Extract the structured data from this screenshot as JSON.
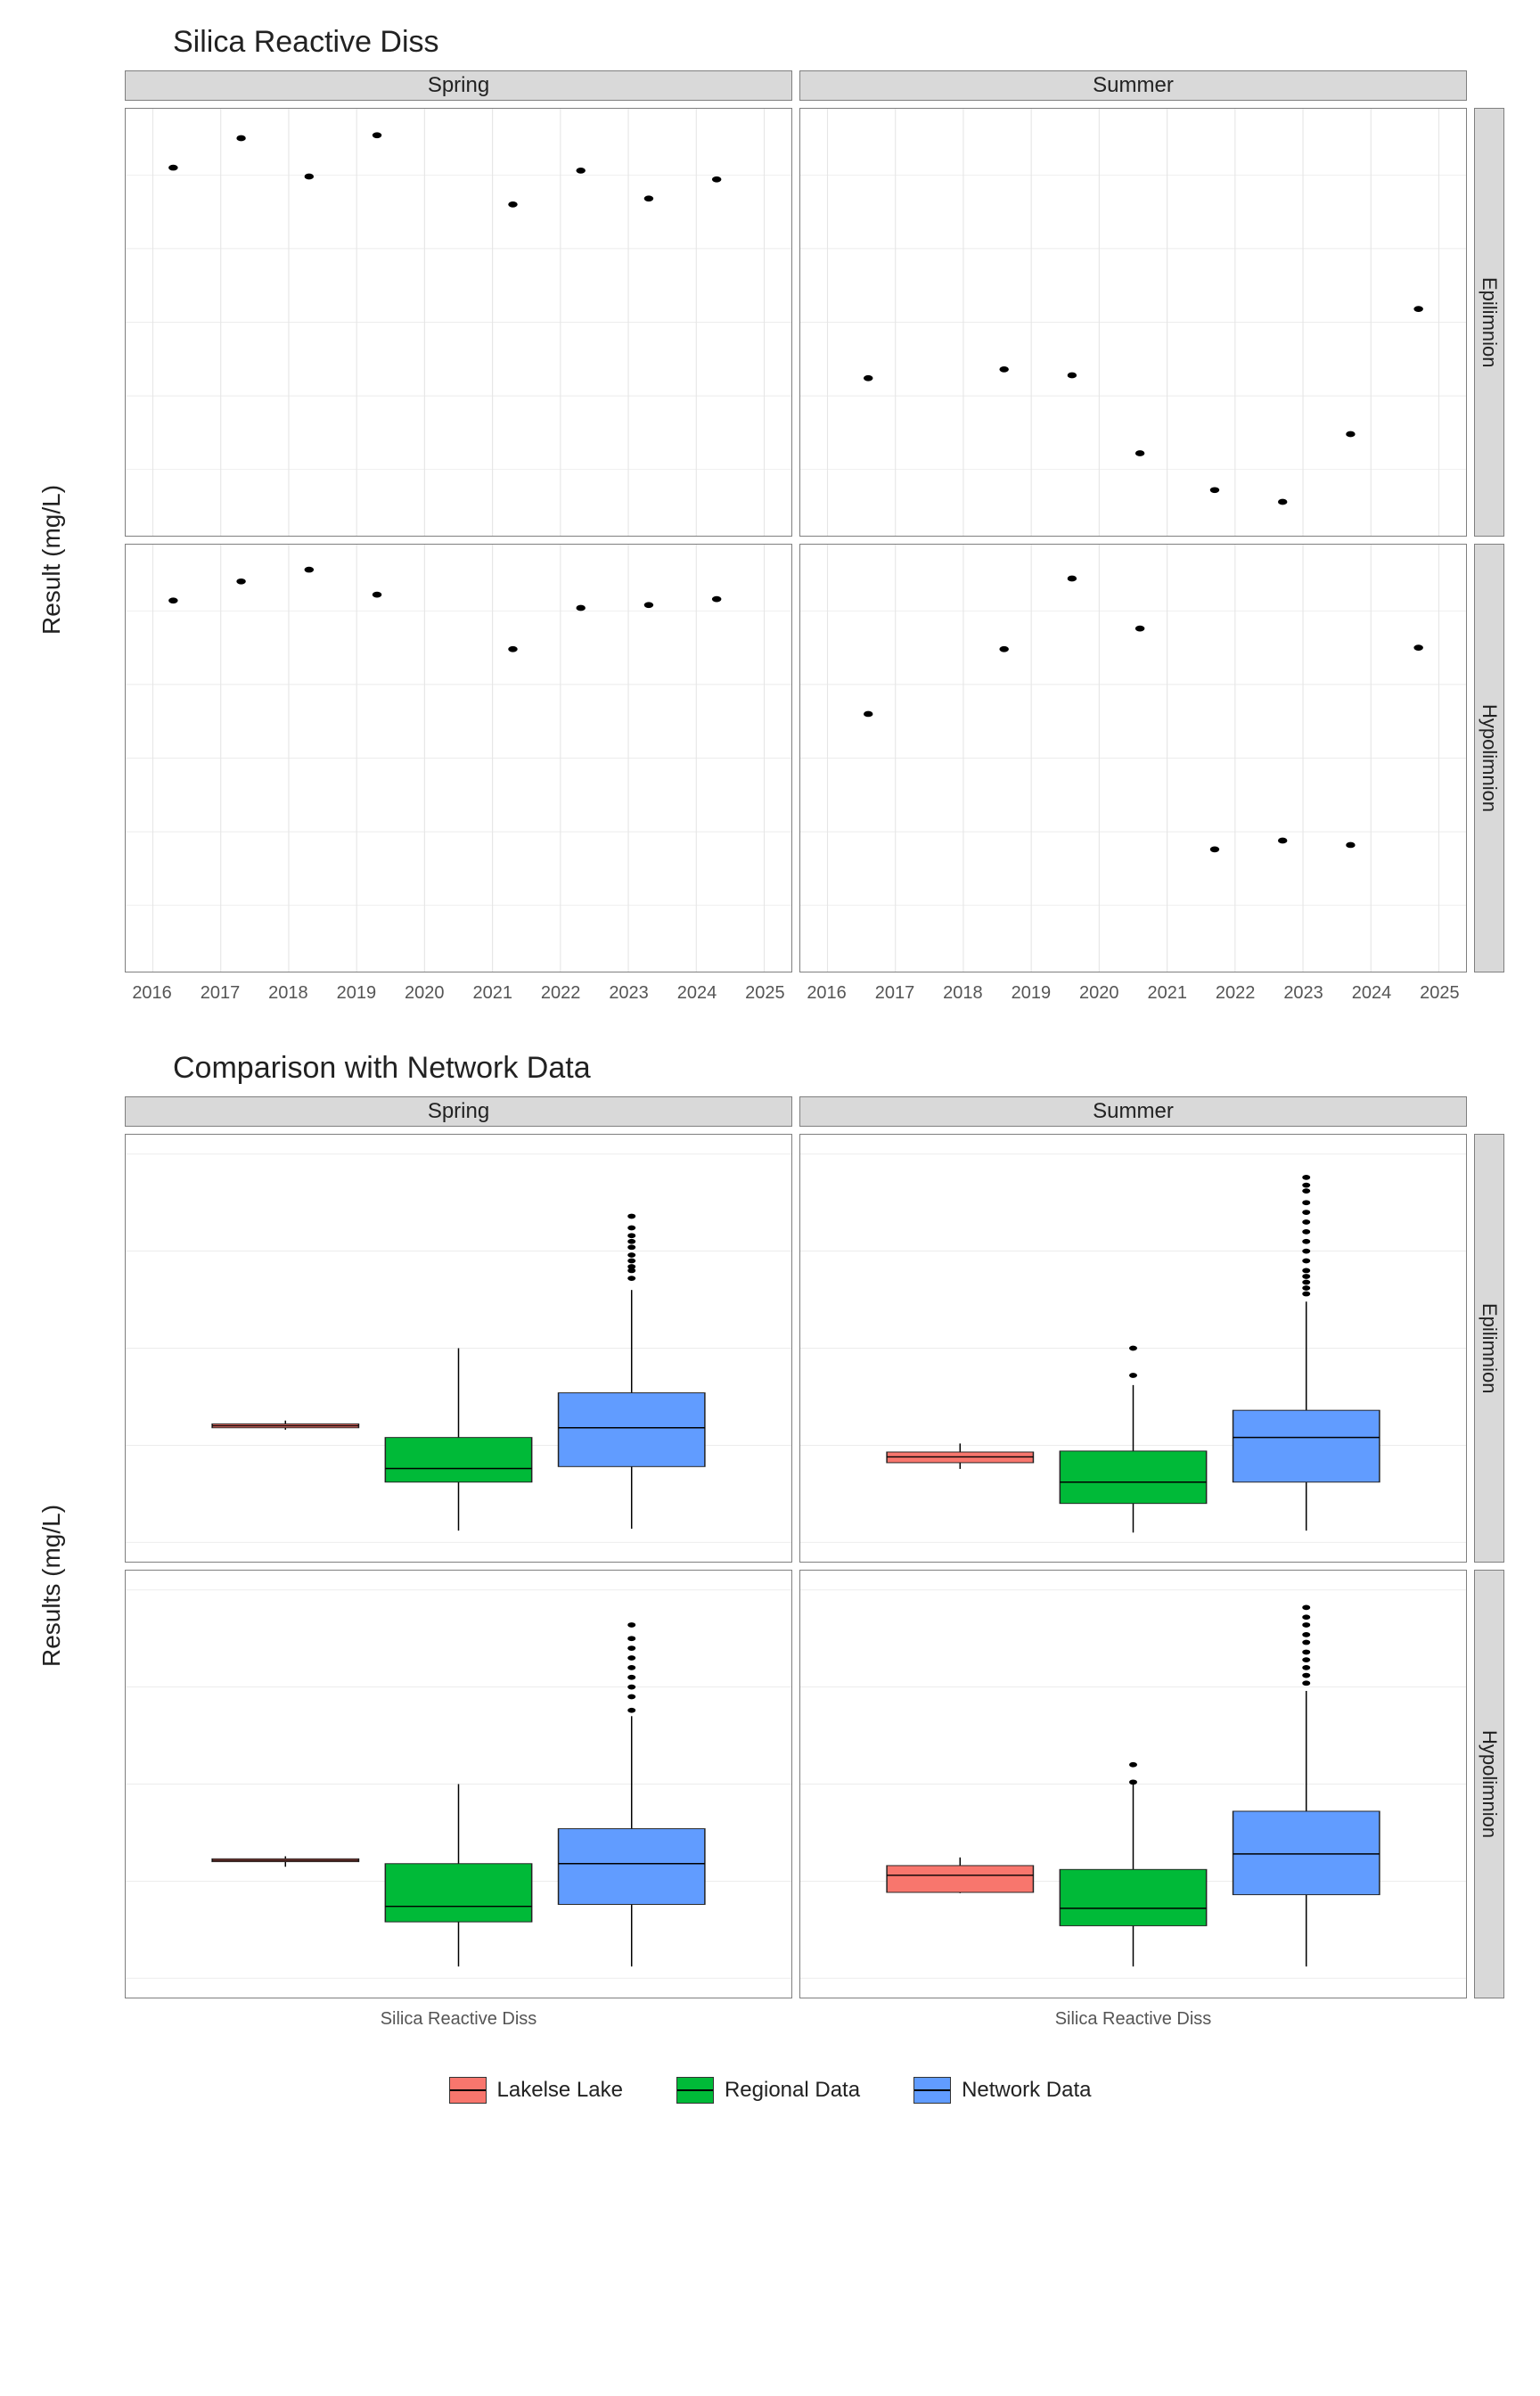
{
  "scatter": {
    "title": "Silica Reactive Diss",
    "ylab": "Result (mg/L)",
    "cols": [
      "Spring",
      "Summer"
    ],
    "rows": [
      "Epilimnion",
      "Hypolimnion"
    ],
    "x_ticks": [
      2016,
      2017,
      2018,
      2019,
      2020,
      2021,
      2022,
      2023,
      2024,
      2025
    ],
    "y_ticks": [
      4.0,
      4.5,
      5.0,
      5.5,
      6.0
    ],
    "xlim": [
      2015.6,
      2025.4
    ],
    "ylim": [
      3.55,
      6.45
    ]
  },
  "box": {
    "title": "Comparison with Network Data",
    "ylab": "Results (mg/L)",
    "cols": [
      "Spring",
      "Summer"
    ],
    "rows": [
      "Epilimnion",
      "Hypolimnion"
    ],
    "xcat": "Silica Reactive Diss",
    "y_ticks": [
      0,
      5,
      10,
      15,
      20
    ],
    "ylim": [
      -1,
      21
    ],
    "groups": [
      "Lakelse Lake",
      "Regional Data",
      "Network Data"
    ],
    "colors": {
      "Lakelse Lake": "#F8766D",
      "Regional Data": "#00BA38",
      "Network Data": "#619CFF"
    }
  },
  "legend": [
    {
      "label": "Lakelse Lake",
      "color": "#F8766D"
    },
    {
      "label": "Regional Data",
      "color": "#00BA38"
    },
    {
      "label": "Network Data",
      "color": "#619CFF"
    }
  ],
  "chart_data": [
    {
      "type": "scatter",
      "title": "Silica Reactive Diss",
      "facets_col": [
        "Spring",
        "Summer"
      ],
      "facets_row": [
        "Epilimnion",
        "Hypolimnion"
      ],
      "xlabel": "",
      "ylabel": "Result (mg/L)",
      "xlim": [
        2015.6,
        2025.4
      ],
      "ylim": [
        3.55,
        6.45
      ],
      "panels": {
        "Spring|Epilimnion": {
          "x": [
            2016.3,
            2017.3,
            2018.3,
            2019.3,
            2021.3,
            2022.3,
            2023.3,
            2024.3
          ],
          "y": [
            6.05,
            6.25,
            5.99,
            6.27,
            5.8,
            6.03,
            5.84,
            5.97
          ]
        },
        "Summer|Epilimnion": {
          "x": [
            2016.6,
            2018.6,
            2019.6,
            2020.6,
            2021.7,
            2022.7,
            2023.7,
            2024.7
          ],
          "y": [
            4.62,
            4.68,
            4.64,
            4.11,
            3.86,
            3.78,
            4.24,
            5.09
          ]
        },
        "Spring|Hypolimnion": {
          "x": [
            2016.3,
            2017.3,
            2018.3,
            2019.3,
            2021.3,
            2022.3,
            2023.3,
            2024.3
          ],
          "y": [
            6.07,
            6.2,
            6.28,
            6.11,
            5.74,
            6.02,
            6.04,
            6.08
          ]
        },
        "Summer|Hypolimnion": {
          "x": [
            2016.6,
            2018.6,
            2019.6,
            2020.6,
            2021.7,
            2022.7,
            2023.7,
            2024.7
          ],
          "y": [
            5.3,
            5.74,
            6.22,
            5.88,
            4.38,
            4.44,
            4.41,
            5.75
          ]
        }
      }
    },
    {
      "type": "box",
      "title": "Comparison with Network Data",
      "facets_col": [
        "Spring",
        "Summer"
      ],
      "facets_row": [
        "Epilimnion",
        "Hypolimnion"
      ],
      "xlabel": "Silica Reactive Diss",
      "ylabel": "Results (mg/L)",
      "ylim": [
        -1,
        21
      ],
      "series_order": [
        "Lakelse Lake",
        "Regional Data",
        "Network Data"
      ],
      "colors": {
        "Lakelse Lake": "#F8766D",
        "Regional Data": "#00BA38",
        "Network Data": "#619CFF"
      },
      "panels": {
        "Spring|Epilimnion": {
          "Lakelse Lake": {
            "min": 5.8,
            "q1": 5.9,
            "med": 6.0,
            "q3": 6.1,
            "max": 6.27,
            "outliers": []
          },
          "Regional Data": {
            "min": 0.6,
            "q1": 3.1,
            "med": 3.8,
            "q3": 5.4,
            "max": 10.0,
            "outliers": []
          },
          "Network Data": {
            "min": 0.7,
            "q1": 3.9,
            "med": 5.9,
            "q3": 7.7,
            "max": 13.0,
            "outliers": [
              13.6,
              14.0,
              14.2,
              14.5,
              14.8,
              15.2,
              15.5,
              15.8,
              16.2,
              16.8
            ]
          }
        },
        "Summer|Epilimnion": {
          "Lakelse Lake": {
            "min": 3.78,
            "q1": 4.1,
            "med": 4.4,
            "q3": 4.65,
            "max": 5.09,
            "outliers": []
          },
          "Regional Data": {
            "min": 0.5,
            "q1": 2.0,
            "med": 3.1,
            "q3": 4.7,
            "max": 8.1,
            "outliers": [
              8.6,
              10.0
            ]
          },
          "Network Data": {
            "min": 0.6,
            "q1": 3.1,
            "med": 5.4,
            "q3": 6.8,
            "max": 12.4,
            "outliers": [
              12.8,
              13.1,
              13.4,
              13.7,
              14.0,
              14.5,
              15.0,
              15.5,
              16.0,
              16.5,
              17.0,
              17.5,
              18.1,
              18.4,
              18.8
            ]
          }
        },
        "Spring|Hypolimnion": {
          "Lakelse Lake": {
            "min": 5.74,
            "q1": 6.0,
            "med": 6.07,
            "q3": 6.15,
            "max": 6.28,
            "outliers": []
          },
          "Regional Data": {
            "min": 0.6,
            "q1": 2.9,
            "med": 3.7,
            "q3": 5.9,
            "max": 10.0,
            "outliers": []
          },
          "Network Data": {
            "min": 0.6,
            "q1": 3.8,
            "med": 5.9,
            "q3": 7.7,
            "max": 13.5,
            "outliers": [
              13.8,
              14.5,
              15.0,
              15.5,
              16.0,
              16.5,
              17.0,
              17.5,
              18.2
            ]
          }
        },
        "Summer|Hypolimnion": {
          "Lakelse Lake": {
            "min": 4.38,
            "q1": 4.42,
            "med": 5.3,
            "q3": 5.8,
            "max": 6.22,
            "outliers": []
          },
          "Regional Data": {
            "min": 0.6,
            "q1": 2.7,
            "med": 3.6,
            "q3": 5.6,
            "max": 10.0,
            "outliers": [
              10.1,
              11.0
            ]
          },
          "Network Data": {
            "min": 0.6,
            "q1": 4.3,
            "med": 6.4,
            "q3": 8.6,
            "max": 14.8,
            "outliers": [
              15.2,
              15.6,
              16.0,
              16.4,
              16.8,
              17.3,
              17.7,
              18.2,
              18.6,
              19.1
            ]
          }
        }
      }
    }
  ]
}
